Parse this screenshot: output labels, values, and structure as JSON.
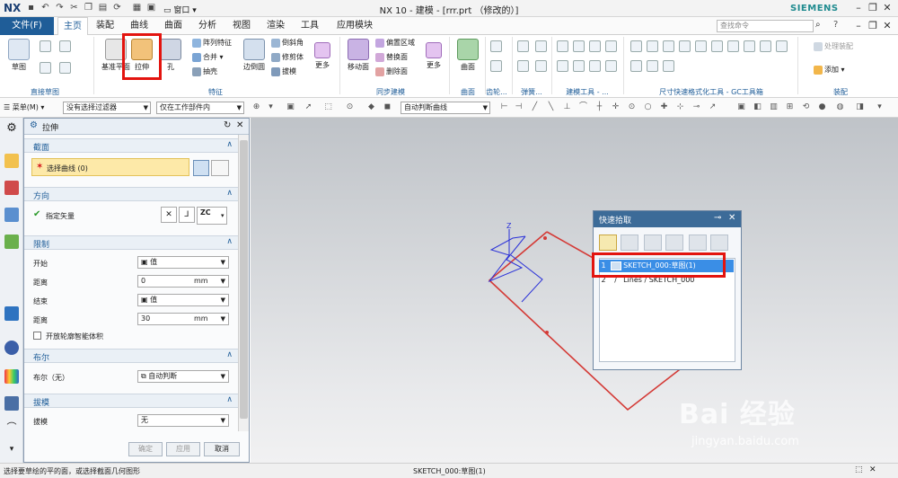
{
  "app": {
    "logo": "NX",
    "title": "NX 10 - 建模 - [rrr.prt （修改的）]",
    "brand": "SIEMENS",
    "window_menu": "窗口"
  },
  "tabs": {
    "file": "文件(F)",
    "items": [
      "主页",
      "装配",
      "曲线",
      "曲面",
      "分析",
      "视图",
      "渲染",
      "工具",
      "应用模块"
    ],
    "active": "主页",
    "search_placeholder": "查找命令"
  },
  "ribbon": {
    "direct_sketch": {
      "label": "直接草图",
      "sketch": "草图"
    },
    "feature": {
      "label": "特征",
      "datum_plane": "基准平面",
      "extrude": "拉伸",
      "hole": "孔",
      "small": [
        "阵列特征",
        "合并",
        "抽壳"
      ],
      "edge_blend": "边倒圆",
      "small2": [
        "倒斜角",
        "修剪体",
        "拔模"
      ],
      "more": "更多"
    },
    "sync": {
      "label": "同步建模",
      "move_face": "移动面",
      "small": [
        "偏置区域",
        "替换面",
        "删除面"
      ],
      "more": "更多"
    },
    "surface": {
      "label": "曲面",
      "btn": "曲面"
    },
    "gear": {
      "label": "齿轮..."
    },
    "spring": {
      "label": "弹簧..."
    },
    "build": {
      "label": "建模工具 - ..."
    },
    "dim": {
      "label": "尺寸快速格式化工具 - GC工具箱"
    },
    "assembly": {
      "label": "装配",
      "wave": "处理装配",
      "add": "添加"
    }
  },
  "filterbar": {
    "menu": "菜单(M)",
    "filter": "没有选择过滤器",
    "scope": "仅在工作部件内",
    "curve_rule": "自动判断曲线"
  },
  "dialog": {
    "title": "拉伸",
    "section": {
      "label": "截面",
      "select_curve": "选择曲线 (0)"
    },
    "direction": {
      "label": "方向",
      "vector": "指定矢量",
      "zc": "ZC"
    },
    "limits": {
      "label": "限制",
      "start_label": "开始",
      "start_value": "值",
      "start_dist_label": "距离",
      "start_dist": "0",
      "end_label": "结束",
      "end_value": "值",
      "end_dist_label": "距离",
      "end_dist": "30",
      "unit": "mm",
      "open_profile": "开放轮廓智能体积"
    },
    "boolean": {
      "label": "布尔",
      "row_label": "布尔（无）",
      "value": "自动判断"
    },
    "draft": {
      "label": "拔模",
      "row_label": "拔模",
      "value": "无"
    },
    "ok": "确定",
    "apply": "应用",
    "cancel": "取消"
  },
  "quickpick": {
    "title": "快速拾取",
    "rows": [
      {
        "num": "1",
        "text": "SKETCH_000:草图(1)"
      },
      {
        "num": "2",
        "text": "Lines / SKETCH_000"
      }
    ]
  },
  "viewport": {
    "axis_label": "Z"
  },
  "status": {
    "left": "选择要草绘的平的面，或选择截面几何图形",
    "center": "SKETCH_000:草图(1)"
  },
  "watermark": {
    "brand": "Bai 经验",
    "url": "jingyan.baidu.com"
  },
  "colors": {
    "accent": "#1f5d98",
    "highlight": "#e3140f",
    "sketch": "#2a31d8",
    "curve": "#d43a36"
  }
}
